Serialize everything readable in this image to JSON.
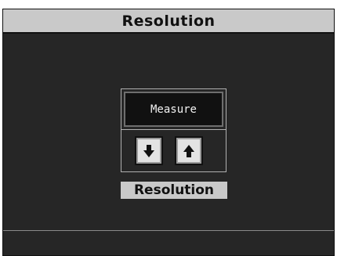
{
  "header": {
    "title": "Resolution"
  },
  "control": {
    "value": "Measure",
    "down_icon": "arrow-down-icon",
    "up_icon": "arrow-up-icon"
  },
  "caption": {
    "label": "Resolution"
  },
  "colors": {
    "screen_background": "#262626",
    "bar_background": "#c9c9c9",
    "display_background": "#111111",
    "button_face": "#e3e3e3"
  }
}
